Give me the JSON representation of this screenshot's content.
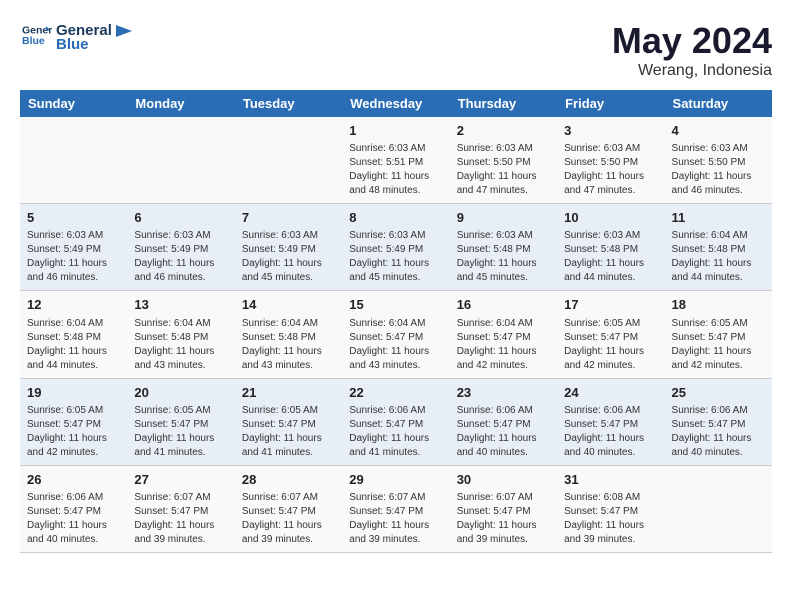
{
  "header": {
    "logo_line1": "General",
    "logo_line2": "Blue",
    "month_year": "May 2024",
    "location": "Werang, Indonesia"
  },
  "weekdays": [
    "Sunday",
    "Monday",
    "Tuesday",
    "Wednesday",
    "Thursday",
    "Friday",
    "Saturday"
  ],
  "weeks": [
    [
      {
        "day": "",
        "content": ""
      },
      {
        "day": "",
        "content": ""
      },
      {
        "day": "",
        "content": ""
      },
      {
        "day": "1",
        "content": "Sunrise: 6:03 AM\nSunset: 5:51 PM\nDaylight: 11 hours and 48 minutes."
      },
      {
        "day": "2",
        "content": "Sunrise: 6:03 AM\nSunset: 5:50 PM\nDaylight: 11 hours and 47 minutes."
      },
      {
        "day": "3",
        "content": "Sunrise: 6:03 AM\nSunset: 5:50 PM\nDaylight: 11 hours and 47 minutes."
      },
      {
        "day": "4",
        "content": "Sunrise: 6:03 AM\nSunset: 5:50 PM\nDaylight: 11 hours and 46 minutes."
      }
    ],
    [
      {
        "day": "5",
        "content": "Sunrise: 6:03 AM\nSunset: 5:49 PM\nDaylight: 11 hours and 46 minutes."
      },
      {
        "day": "6",
        "content": "Sunrise: 6:03 AM\nSunset: 5:49 PM\nDaylight: 11 hours and 46 minutes."
      },
      {
        "day": "7",
        "content": "Sunrise: 6:03 AM\nSunset: 5:49 PM\nDaylight: 11 hours and 45 minutes."
      },
      {
        "day": "8",
        "content": "Sunrise: 6:03 AM\nSunset: 5:49 PM\nDaylight: 11 hours and 45 minutes."
      },
      {
        "day": "9",
        "content": "Sunrise: 6:03 AM\nSunset: 5:48 PM\nDaylight: 11 hours and 45 minutes."
      },
      {
        "day": "10",
        "content": "Sunrise: 6:03 AM\nSunset: 5:48 PM\nDaylight: 11 hours and 44 minutes."
      },
      {
        "day": "11",
        "content": "Sunrise: 6:04 AM\nSunset: 5:48 PM\nDaylight: 11 hours and 44 minutes."
      }
    ],
    [
      {
        "day": "12",
        "content": "Sunrise: 6:04 AM\nSunset: 5:48 PM\nDaylight: 11 hours and 44 minutes."
      },
      {
        "day": "13",
        "content": "Sunrise: 6:04 AM\nSunset: 5:48 PM\nDaylight: 11 hours and 43 minutes."
      },
      {
        "day": "14",
        "content": "Sunrise: 6:04 AM\nSunset: 5:48 PM\nDaylight: 11 hours and 43 minutes."
      },
      {
        "day": "15",
        "content": "Sunrise: 6:04 AM\nSunset: 5:47 PM\nDaylight: 11 hours and 43 minutes."
      },
      {
        "day": "16",
        "content": "Sunrise: 6:04 AM\nSunset: 5:47 PM\nDaylight: 11 hours and 42 minutes."
      },
      {
        "day": "17",
        "content": "Sunrise: 6:05 AM\nSunset: 5:47 PM\nDaylight: 11 hours and 42 minutes."
      },
      {
        "day": "18",
        "content": "Sunrise: 6:05 AM\nSunset: 5:47 PM\nDaylight: 11 hours and 42 minutes."
      }
    ],
    [
      {
        "day": "19",
        "content": "Sunrise: 6:05 AM\nSunset: 5:47 PM\nDaylight: 11 hours and 42 minutes."
      },
      {
        "day": "20",
        "content": "Sunrise: 6:05 AM\nSunset: 5:47 PM\nDaylight: 11 hours and 41 minutes."
      },
      {
        "day": "21",
        "content": "Sunrise: 6:05 AM\nSunset: 5:47 PM\nDaylight: 11 hours and 41 minutes."
      },
      {
        "day": "22",
        "content": "Sunrise: 6:06 AM\nSunset: 5:47 PM\nDaylight: 11 hours and 41 minutes."
      },
      {
        "day": "23",
        "content": "Sunrise: 6:06 AM\nSunset: 5:47 PM\nDaylight: 11 hours and 40 minutes."
      },
      {
        "day": "24",
        "content": "Sunrise: 6:06 AM\nSunset: 5:47 PM\nDaylight: 11 hours and 40 minutes."
      },
      {
        "day": "25",
        "content": "Sunrise: 6:06 AM\nSunset: 5:47 PM\nDaylight: 11 hours and 40 minutes."
      }
    ],
    [
      {
        "day": "26",
        "content": "Sunrise: 6:06 AM\nSunset: 5:47 PM\nDaylight: 11 hours and 40 minutes."
      },
      {
        "day": "27",
        "content": "Sunrise: 6:07 AM\nSunset: 5:47 PM\nDaylight: 11 hours and 39 minutes."
      },
      {
        "day": "28",
        "content": "Sunrise: 6:07 AM\nSunset: 5:47 PM\nDaylight: 11 hours and 39 minutes."
      },
      {
        "day": "29",
        "content": "Sunrise: 6:07 AM\nSunset: 5:47 PM\nDaylight: 11 hours and 39 minutes."
      },
      {
        "day": "30",
        "content": "Sunrise: 6:07 AM\nSunset: 5:47 PM\nDaylight: 11 hours and 39 minutes."
      },
      {
        "day": "31",
        "content": "Sunrise: 6:08 AM\nSunset: 5:47 PM\nDaylight: 11 hours and 39 minutes."
      },
      {
        "day": "",
        "content": ""
      }
    ]
  ]
}
